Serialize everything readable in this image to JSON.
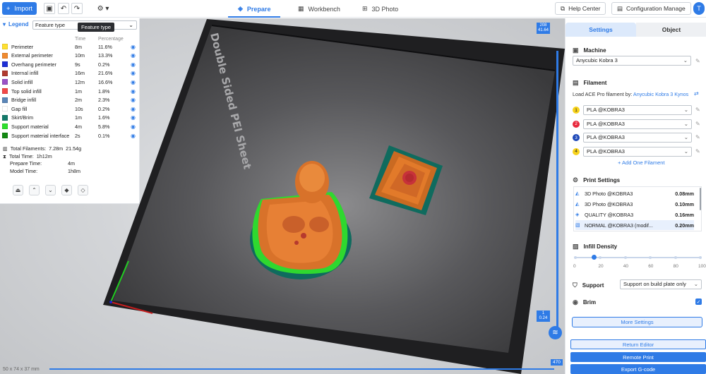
{
  "toolbar": {
    "import_label": "Import",
    "import_icon": "plus-icon"
  },
  "tabs": [
    {
      "label": "Prepare",
      "active": true
    },
    {
      "label": "Workbench",
      "active": false
    },
    {
      "label": "3D Photo",
      "active": false
    }
  ],
  "header": {
    "help_label": "Help Center",
    "config_label": "Configuration Manage",
    "avatar_letter": "T"
  },
  "legend": {
    "title": "Legend",
    "select_value": "Feature type",
    "tooltip": "Feature type",
    "col_time": "Time",
    "col_pct": "Percentage",
    "items": [
      {
        "name": "Perimeter",
        "time": "8m",
        "pct": "11.6%",
        "color": "#ffe030"
      },
      {
        "name": "External perimeter",
        "time": "10m",
        "pct": "13.3%",
        "color": "#f08a2e"
      },
      {
        "name": "Overhang perimeter",
        "time": "9s",
        "pct": "0.2%",
        "color": "#1d2fd6"
      },
      {
        "name": "Internal infill",
        "time": "16m",
        "pct": "21.6%",
        "color": "#b03a2e"
      },
      {
        "name": "Solid infill",
        "time": "12m",
        "pct": "16.6%",
        "color": "#9a52c7"
      },
      {
        "name": "Top solid infill",
        "time": "1m",
        "pct": "1.8%",
        "color": "#f24848"
      },
      {
        "name": "Bridge infill",
        "time": "2m",
        "pct": "2.3%",
        "color": "#5b86b8"
      },
      {
        "name": "Gap fill",
        "time": "10s",
        "pct": "0.2%",
        "color": "#ffffff"
      },
      {
        "name": "Skirt/Brim",
        "time": "1m",
        "pct": "1.6%",
        "color": "#127a6a"
      },
      {
        "name": "Support material",
        "time": "4m",
        "pct": "5.8%",
        "color": "#2ee02e"
      },
      {
        "name": "Support material interface",
        "time": "2s",
        "pct": "0.1%",
        "color": "#138a13"
      }
    ],
    "totals": {
      "filament_label": "Total Filaments:",
      "filament_len": "7.28m",
      "filament_weight": "21.54g",
      "time_label": "Total Time:",
      "time_value": "1h12m",
      "prepare_label": "Prepare Time:",
      "prepare_value": "4m",
      "model_label": "Model Time:",
      "model_value": "1h8m"
    }
  },
  "viewport": {
    "plate_text": "Double Sided PEI Sheet",
    "slider_top": "208",
    "slider_top_sub": "41.64",
    "slider_bottom": "1",
    "slider_bottom_sub": "0.24",
    "h_slider_value": "470",
    "dimensions": "50 x 74 x 37 mm"
  },
  "sidebar": {
    "tab_settings": "Settings",
    "tab_object": "Object",
    "machine_title": "Machine",
    "machine_value": "Anycubic Kobra 3",
    "filament_title": "Filament",
    "load_text": "Load ACE Pro filament by:",
    "load_link": "Anycubic Kobra 3 Kynos",
    "filaments": [
      {
        "num": "1",
        "value": "PLA @KOBRA3",
        "color": "#f7d21b"
      },
      {
        "num": "2",
        "value": "PLA @KOBRA3",
        "color": "#e8283c"
      },
      {
        "num": "3",
        "value": "PLA @KOBRA3",
        "color": "#1e48b8"
      },
      {
        "num": "4",
        "value": "PLA @KOBRA3",
        "color": "#f7d21b"
      }
    ],
    "add_filament": "+ Add One Filament",
    "print_settings_title": "Print Settings",
    "presets": [
      {
        "name": "3D Photo @KOBRA3",
        "value": "0.08mm"
      },
      {
        "name": "3D Photo @KOBRA3",
        "value": "0.10mm"
      },
      {
        "name": "QUALITY @KOBRA3",
        "value": "0.16mm"
      },
      {
        "name": "NORMAL @KOBRA3 (modif...",
        "value": "0.20mm"
      }
    ],
    "infill_title": "Infill Density",
    "infill_value": 0.15,
    "infill_ticks": [
      "0",
      "20",
      "40",
      "60",
      "80",
      "100"
    ],
    "support_title": "Support",
    "support_value": "Support on build plate only",
    "brim_title": "Brim",
    "more_settings": "More Settings",
    "return_editor": "Return Editor",
    "remote_print": "Remote Print",
    "export_gcode": "Export G-code"
  }
}
